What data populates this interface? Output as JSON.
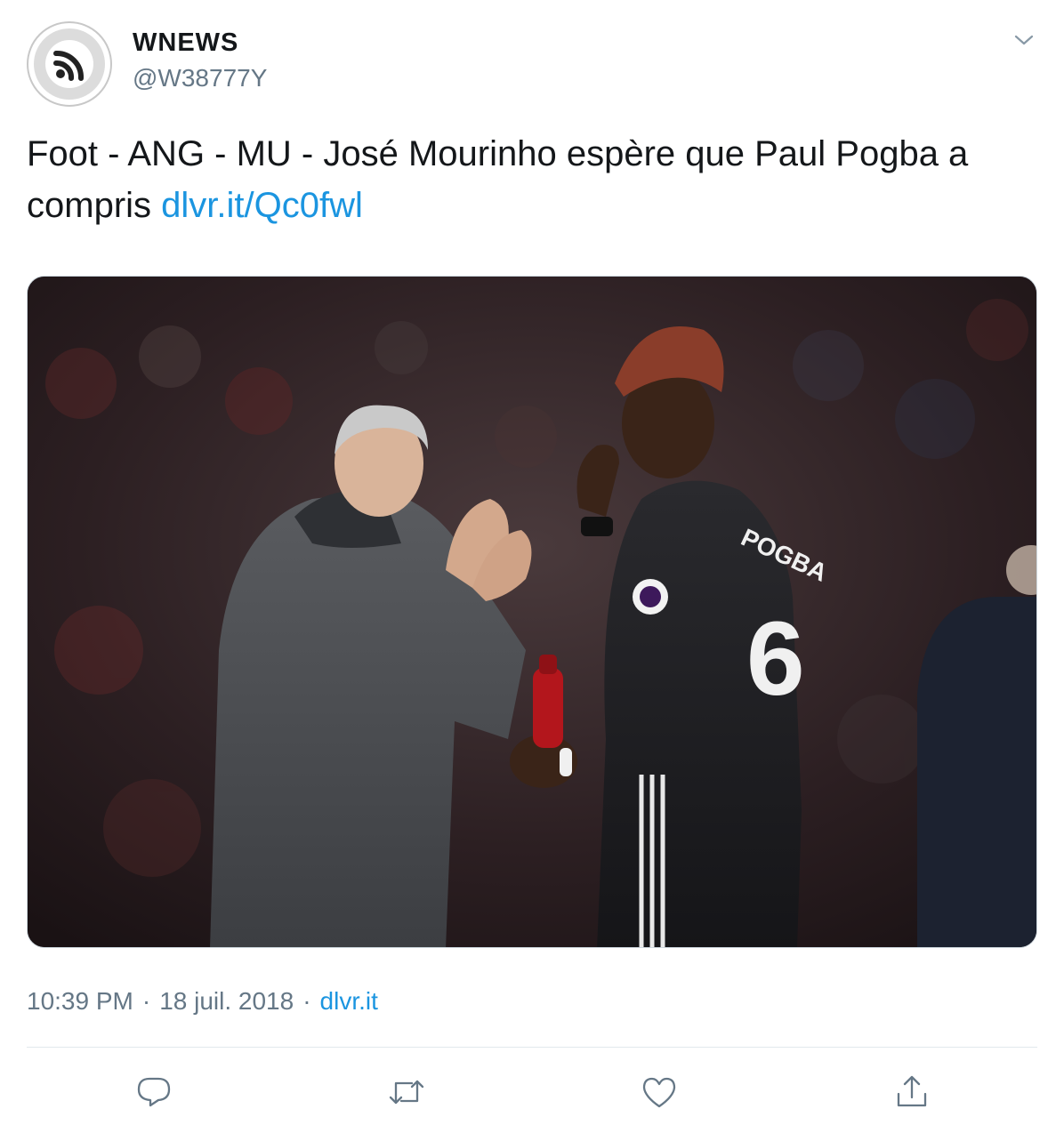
{
  "tweet": {
    "display_name": "WNEWS",
    "handle": "@W38777Y",
    "text": "Foot - ANG - MU - José Mourinho espère que Paul Pogba a compris",
    "link": "dlvr.it/Qc0fwl",
    "time": "10:39 PM",
    "date": "18 juil. 2018",
    "source": "dlvr.it",
    "separator": "·"
  },
  "media": {
    "jersey_name": "POGBA",
    "jersey_number": "6"
  },
  "icons": {
    "avatar": "rss-icon",
    "caret": "chevron-down-icon",
    "reply": "reply-icon",
    "retweet": "retweet-icon",
    "like": "heart-icon",
    "share": "share-icon"
  },
  "colors": {
    "link": "#1b95e0",
    "secondary": "#657786",
    "text": "#14171a",
    "divider": "#e1e8ed"
  }
}
